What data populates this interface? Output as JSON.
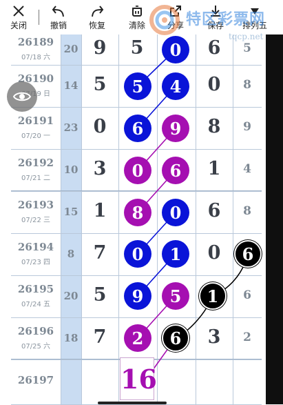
{
  "toolbar": {
    "close": "关闭",
    "undo": "撤销",
    "redo": "恢复",
    "clear": "清除",
    "share": "分享",
    "save": "保存",
    "arrange": "排列五"
  },
  "watermark": {
    "text": "特区彩票网",
    "sub": "tqcp.net"
  },
  "rows": [
    {
      "period": "26189",
      "date": "07/18 六",
      "sum": "20",
      "d1": "9",
      "d2": "5",
      "d3": "",
      "d4": "6",
      "last": "5"
    },
    {
      "period": "26190",
      "date": "07/19 日",
      "sum": "14",
      "d1": "5",
      "d2": "",
      "d3": "",
      "d4": "0",
      "last": "8"
    },
    {
      "period": "26191",
      "date": "07/20 一",
      "sum": "23",
      "d1": "0",
      "d2": "",
      "d3": "",
      "d4": "8",
      "last": "9"
    },
    {
      "period": "26192",
      "date": "07/21 二",
      "sum": "10",
      "d1": "3",
      "d2": "",
      "d3": "",
      "d4": "1",
      "last": "4"
    },
    {
      "period": "26193",
      "date": "07/22 三",
      "sum": "15",
      "d1": "1",
      "d2": "",
      "d3": "",
      "d4": "6",
      "last": "8"
    },
    {
      "period": "26194",
      "date": "07/23 四",
      "sum": "8",
      "d1": "7",
      "d2": "",
      "d3": "",
      "d4": "0",
      "last": ""
    },
    {
      "period": "26195",
      "date": "07/24 五",
      "sum": "20",
      "d1": "5",
      "d2": "",
      "d3": "",
      "d4": "",
      "last": "6"
    },
    {
      "period": "26196",
      "date": "07/25 六",
      "sum": "18",
      "d1": "7",
      "d2": "",
      "d3": "",
      "d4": "3",
      "last": "2"
    }
  ],
  "next_period": "26197",
  "balls": {
    "r0c3": "0",
    "r1c2": "5",
    "r1c3": "4",
    "r2c2": "6",
    "r2c3": "9",
    "r3c2": "0",
    "r3c3": "6",
    "r4c2": "8",
    "r4c3": "0",
    "r5c2": "0",
    "r5c3": "1",
    "r5c5": "6",
    "r6c2": "9",
    "r6c3": "5",
    "r6c4": "1",
    "r7c2": "2",
    "r7c3": "6"
  },
  "guess_value": "16",
  "colors": {
    "blue_ball": "#0a14d8",
    "purple_ball": "#a50fb1",
    "black_ball": "#000000",
    "sum_column": "#c9dcf2"
  },
  "icons": [
    "close-icon",
    "undo-icon",
    "redo-icon",
    "clear-icon",
    "share-icon",
    "save-icon",
    "dropdown-icon",
    "eye-icon"
  ]
}
